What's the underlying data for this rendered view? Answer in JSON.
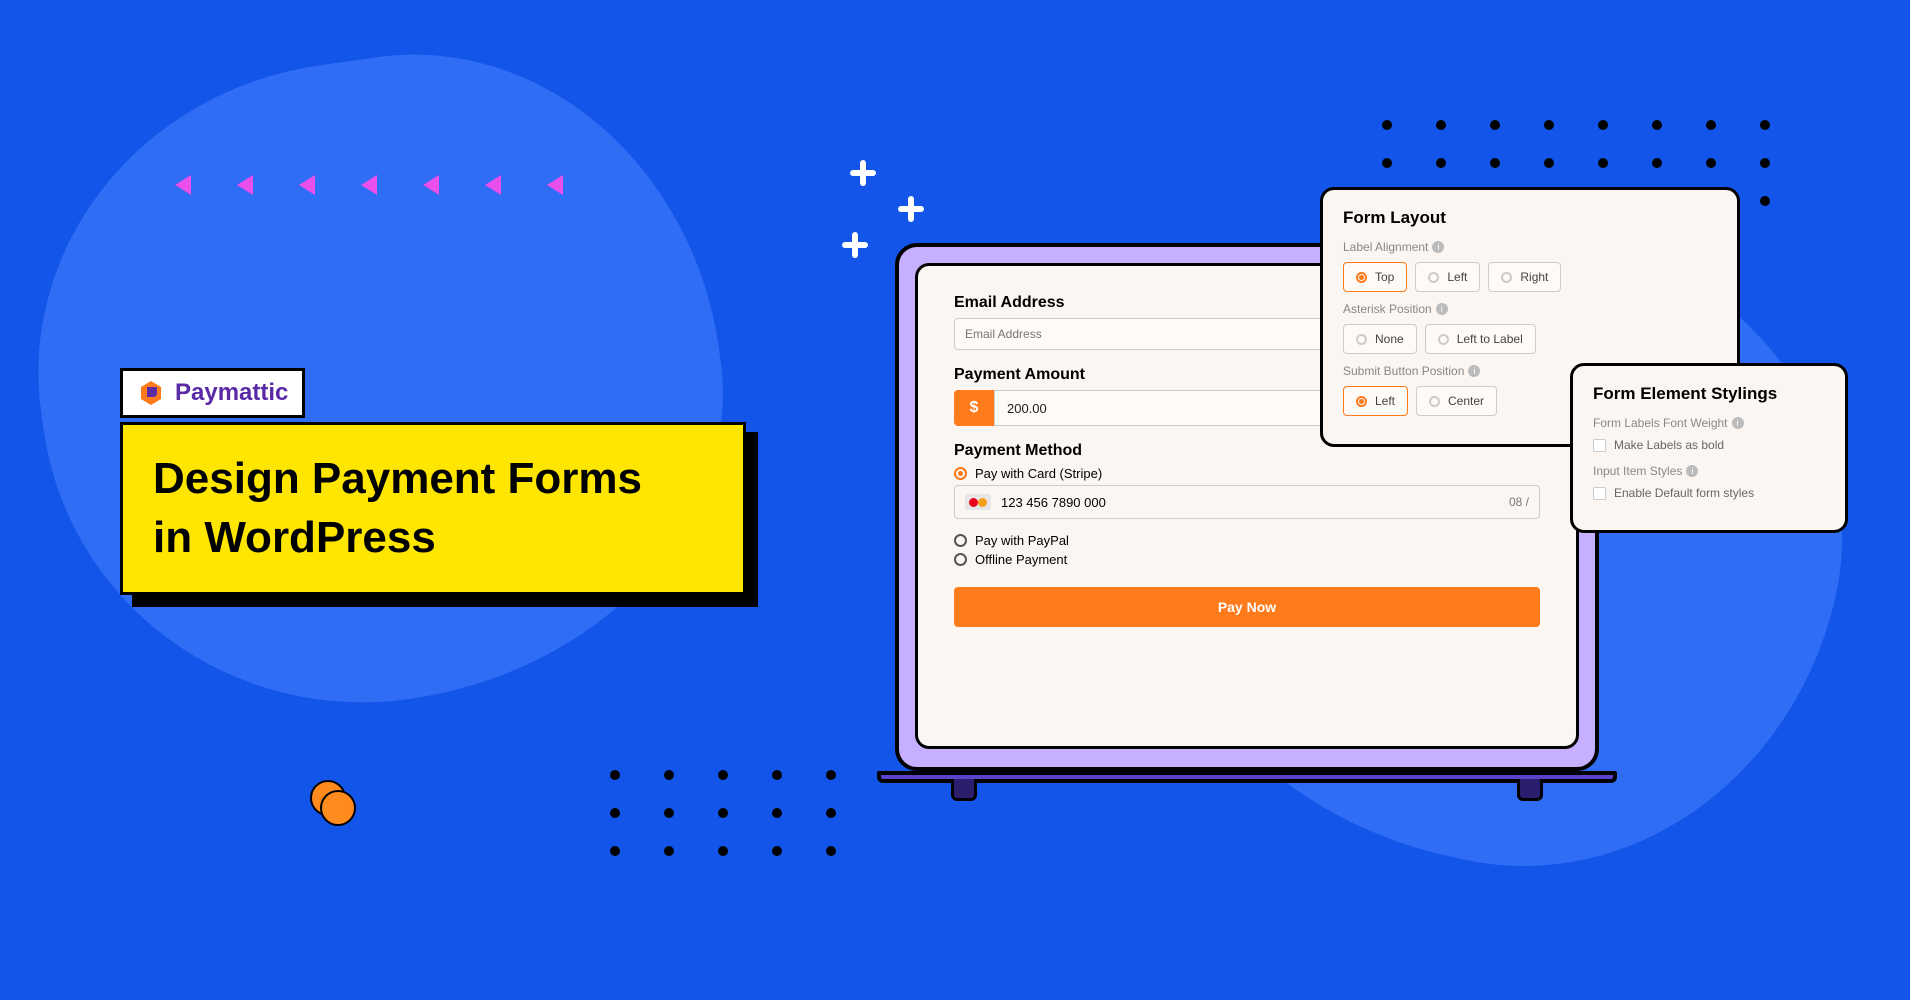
{
  "brand": {
    "name": "Paymattic"
  },
  "title": {
    "line1": "Design Payment Forms",
    "line2": "in WordPress"
  },
  "form": {
    "email_label": "Email Address",
    "email_placeholder": "Email Address",
    "amount_label": "Payment Amount",
    "amount_symbol": "$",
    "amount_value": "200.00",
    "method_label": "Payment Method",
    "method_stripe": "Pay with Card (Stripe)",
    "method_paypal": "Pay with PayPal",
    "method_offline": "Offline Payment",
    "card_number": "123 456 7890 000",
    "card_expiry": "08 /",
    "submit_label": "Pay Now"
  },
  "layout_panel": {
    "title": "Form Layout",
    "label_alignment_label": "Label Alignment",
    "opt_top": "Top",
    "opt_left": "Left",
    "opt_right": "Right",
    "asterisk_label": "Asterisk Position",
    "opt_none": "None",
    "opt_left_to_label": "Left to Label",
    "submit_pos_label": "Submit Button Position",
    "opt_sleft": "Left",
    "opt_scenter": "Center"
  },
  "stylings_panel": {
    "title": "Form Element Stylings",
    "font_weight_label": "Form Labels Font Weight",
    "bold_checkbox": "Make Labels as bold",
    "input_styles_label": "Input Item Styles",
    "default_styles_checkbox": "Enable Default form styles"
  }
}
